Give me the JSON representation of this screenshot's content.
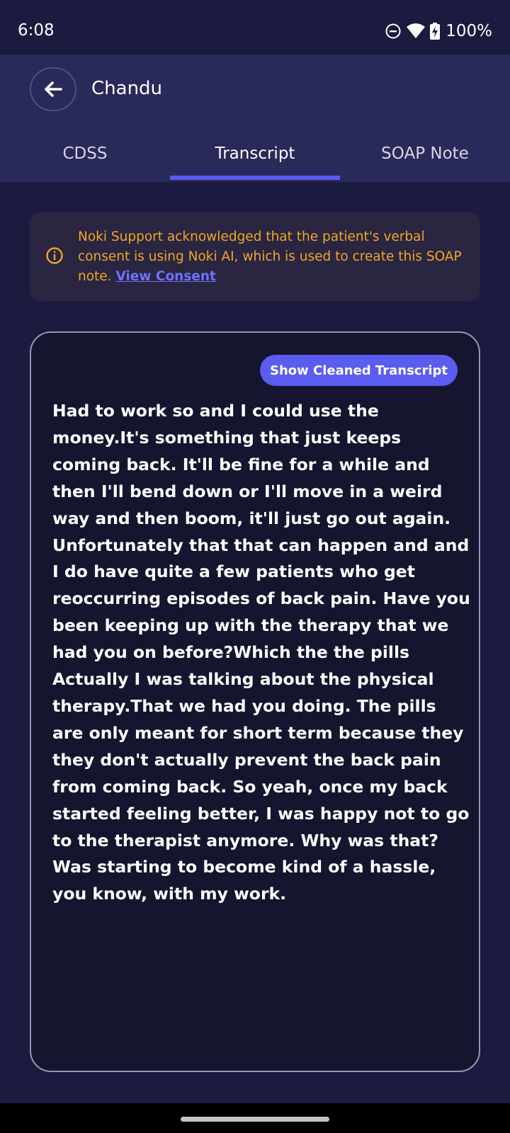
{
  "status_bar": {
    "time": "6:08",
    "battery": "100%",
    "icons": [
      "do-not-disturb-icon",
      "wifi-icon",
      "battery-charging-icon"
    ]
  },
  "header": {
    "title": "Chandu",
    "back_icon": "arrow-left-icon"
  },
  "tabs": [
    {
      "label": "CDSS",
      "active": false
    },
    {
      "label": "Transcript",
      "active": true
    },
    {
      "label": "SOAP Note",
      "active": false
    }
  ],
  "consent": {
    "icon": "info-icon",
    "text": "Noki Support acknowledged that the patient's verbal consent is using Noki AI, which is used to create this SOAP note. ",
    "link_label": "View Consent"
  },
  "transcript": {
    "button_label": "Show Cleaned Transcript",
    "text": "Had to work so and I could use the money.It's something that just keeps coming back. It'll be fine for a while and then I'll bend down or I'll move in a weird way and then boom, it'll just go out again. Unfortunately that that can happen and and I do have quite a few patients who get reoccurring episodes of back pain. Have you been keeping up with the therapy that we had you on before?Which the the pills Actually I was talking about the physical therapy.That we had you doing. The pills are only meant for short term because they they don't actually prevent the back pain from coming back. So yeah, once my back started feeling better, I was happy not to go to the therapist anymore. Why was that? Was starting to become kind of a hassle, you know, with my work."
  },
  "colors": {
    "background": "#1b1b40",
    "header": "#29295a",
    "accent": "#5b5cf0",
    "warning": "#f0a728",
    "link": "#6f71ff"
  }
}
